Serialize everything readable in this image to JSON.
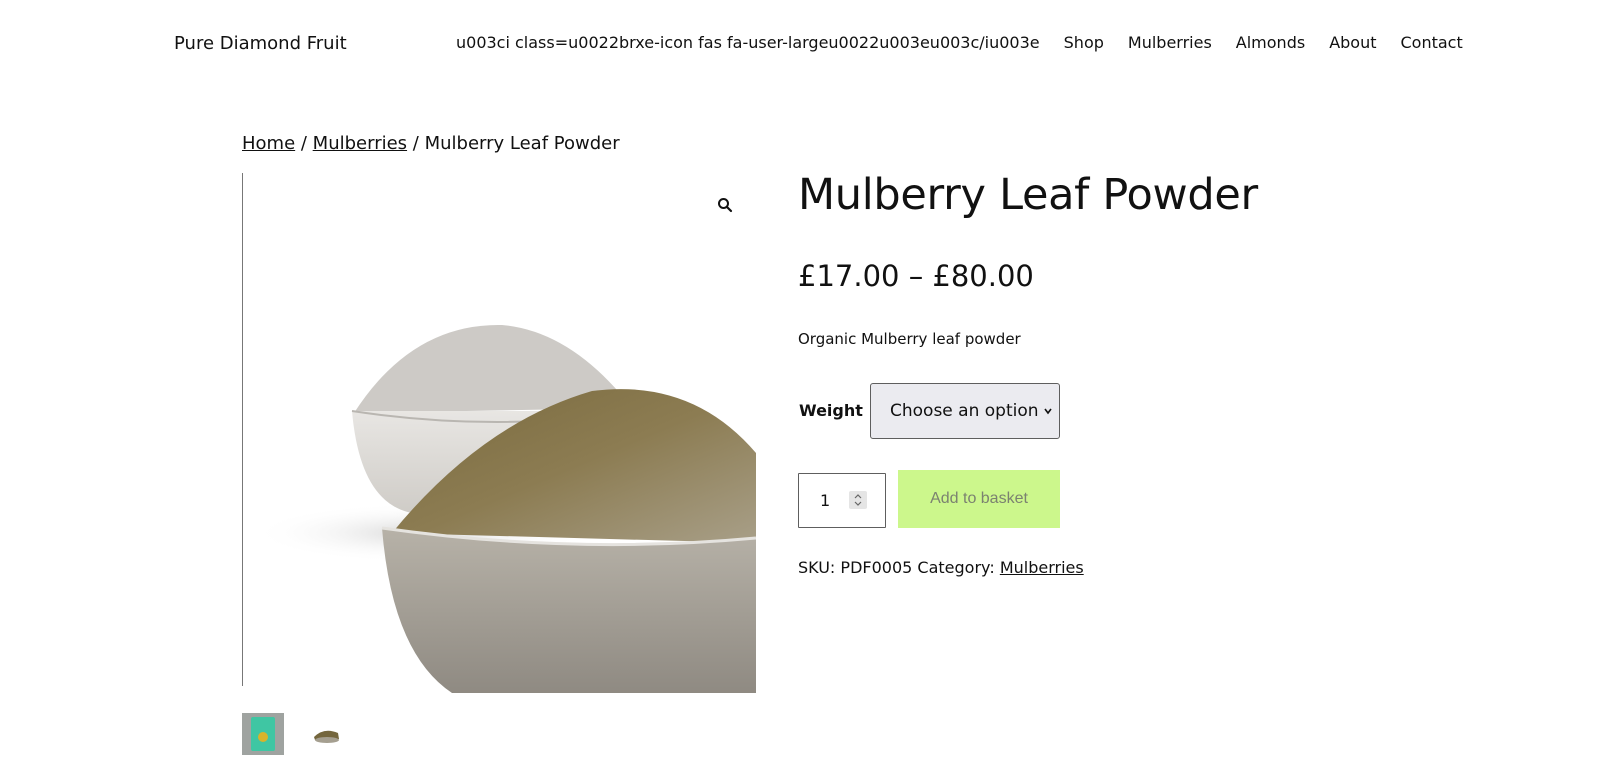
{
  "header": {
    "site_title": "Pure Diamond Fruit",
    "nav": [
      "u003ci class=u0022brxe-icon fas fa-user-largeu0022u003eu003c/iu003e",
      "Shop",
      "Mulberries",
      "Almonds",
      "About",
      "Contact"
    ]
  },
  "breadcrumb": {
    "home": "Home",
    "sep1": " / ",
    "category": "Mulberries",
    "sep2": " / ",
    "current": "Mulberry Leaf Powder"
  },
  "product": {
    "title": "Mulberry Leaf Powder",
    "price": "£17.00 – £80.00",
    "short_description": "Organic Mulberry leaf powder",
    "variation_label": "Weight",
    "variation_value": "Choose an option",
    "quantity": "1",
    "add_to_basket": "Add to basket",
    "sku_label": "SKU:",
    "sku": "PDF0005",
    "category_label": "Category:",
    "category": "Mulberries"
  },
  "icons": {
    "zoom": "magnifier-icon",
    "select": "chevron-down-icon",
    "stepper": "up-down-icon"
  },
  "colors": {
    "add_button_bg": "#ccf78c",
    "add_button_text": "#7b8270",
    "select_bg": "#ebebf0"
  }
}
